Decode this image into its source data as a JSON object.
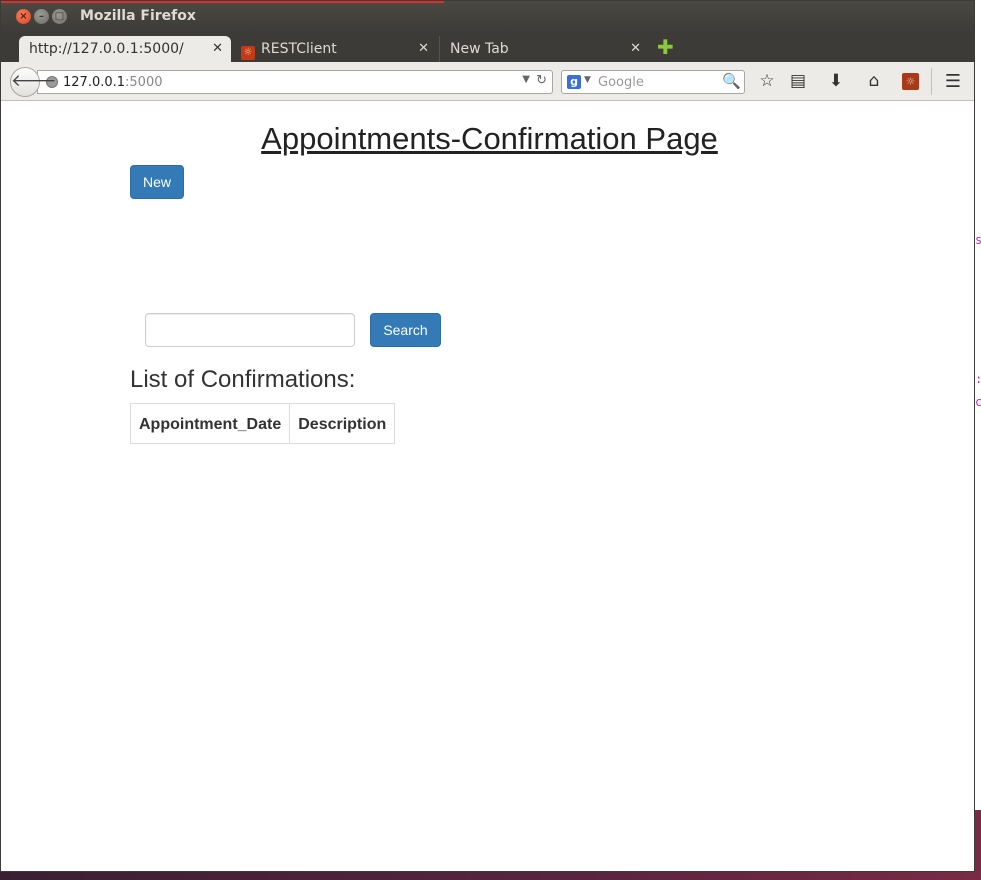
{
  "window": {
    "title": "Mozilla Firefox"
  },
  "tabs": [
    {
      "label": "http://127.0.0.1:5000/",
      "active": true
    },
    {
      "label": "RESTClient",
      "active": false,
      "icon": "restclient-icon"
    },
    {
      "label": "New Tab",
      "active": false
    }
  ],
  "navbar": {
    "url_host": "127.0.0.1",
    "url_port": ":5000",
    "search_placeholder": "Google"
  },
  "page": {
    "title": "Appointments-Confirmation Page",
    "new_button": "New",
    "search_input_value": "",
    "search_button": "Search",
    "list_heading": "List of Confirmations:",
    "table": {
      "columns": [
        "Appointment_Date",
        "Description"
      ],
      "rows": []
    }
  },
  "colors": {
    "primary_button": "#337ab7",
    "titlebar": "#3c3b37",
    "close_button": "#d9451e",
    "new_tab_plus": "#8dc63f"
  }
}
